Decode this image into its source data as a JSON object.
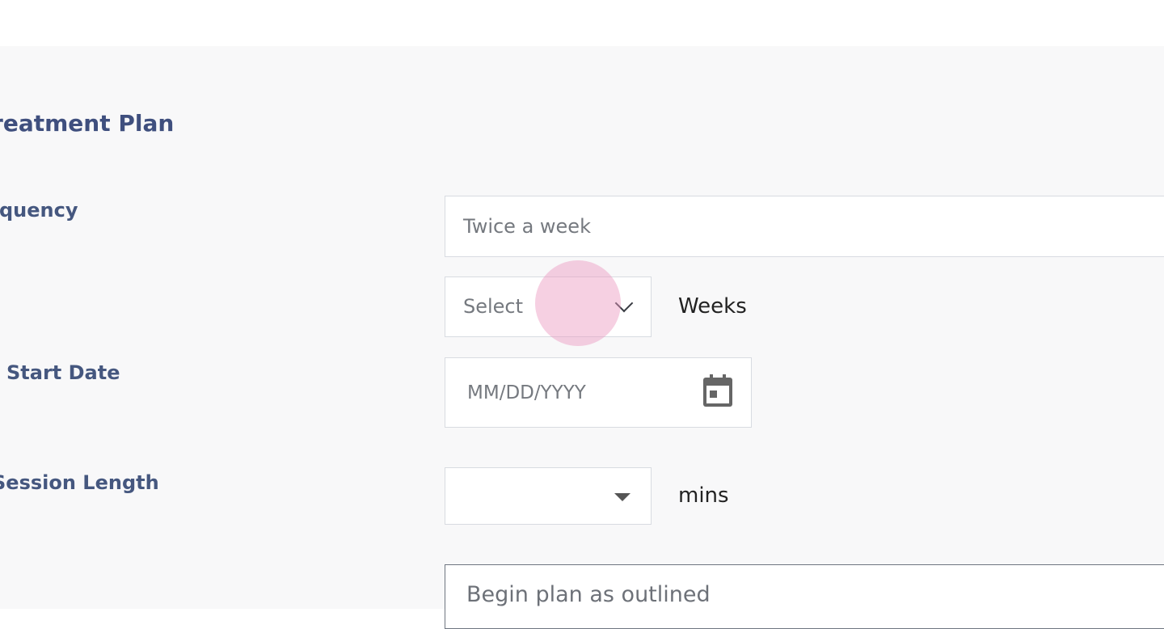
{
  "section": {
    "title": "Treatment Plan"
  },
  "rows": {
    "frequency": {
      "label": "Frequency",
      "placeholder": "Twice a week"
    },
    "duration": {
      "select_value": "Select",
      "unit": "Weeks"
    },
    "date": {
      "label": "Start Date",
      "placeholder": "MM/DD/YYYY"
    },
    "length": {
      "label": "Session Length",
      "select_value": "",
      "unit": "mins"
    },
    "notes": {
      "placeholder": "Begin plan as outlined"
    }
  },
  "colors": {
    "label": "#45577f",
    "panel_bg": "#f8f8f9",
    "field_border": "#d8dbe1",
    "click_indicator": "#ec96be"
  },
  "icons": {
    "duration_select": "chevron-down-icon",
    "date_picker": "calendar-icon",
    "length_select": "caret-down-icon"
  }
}
